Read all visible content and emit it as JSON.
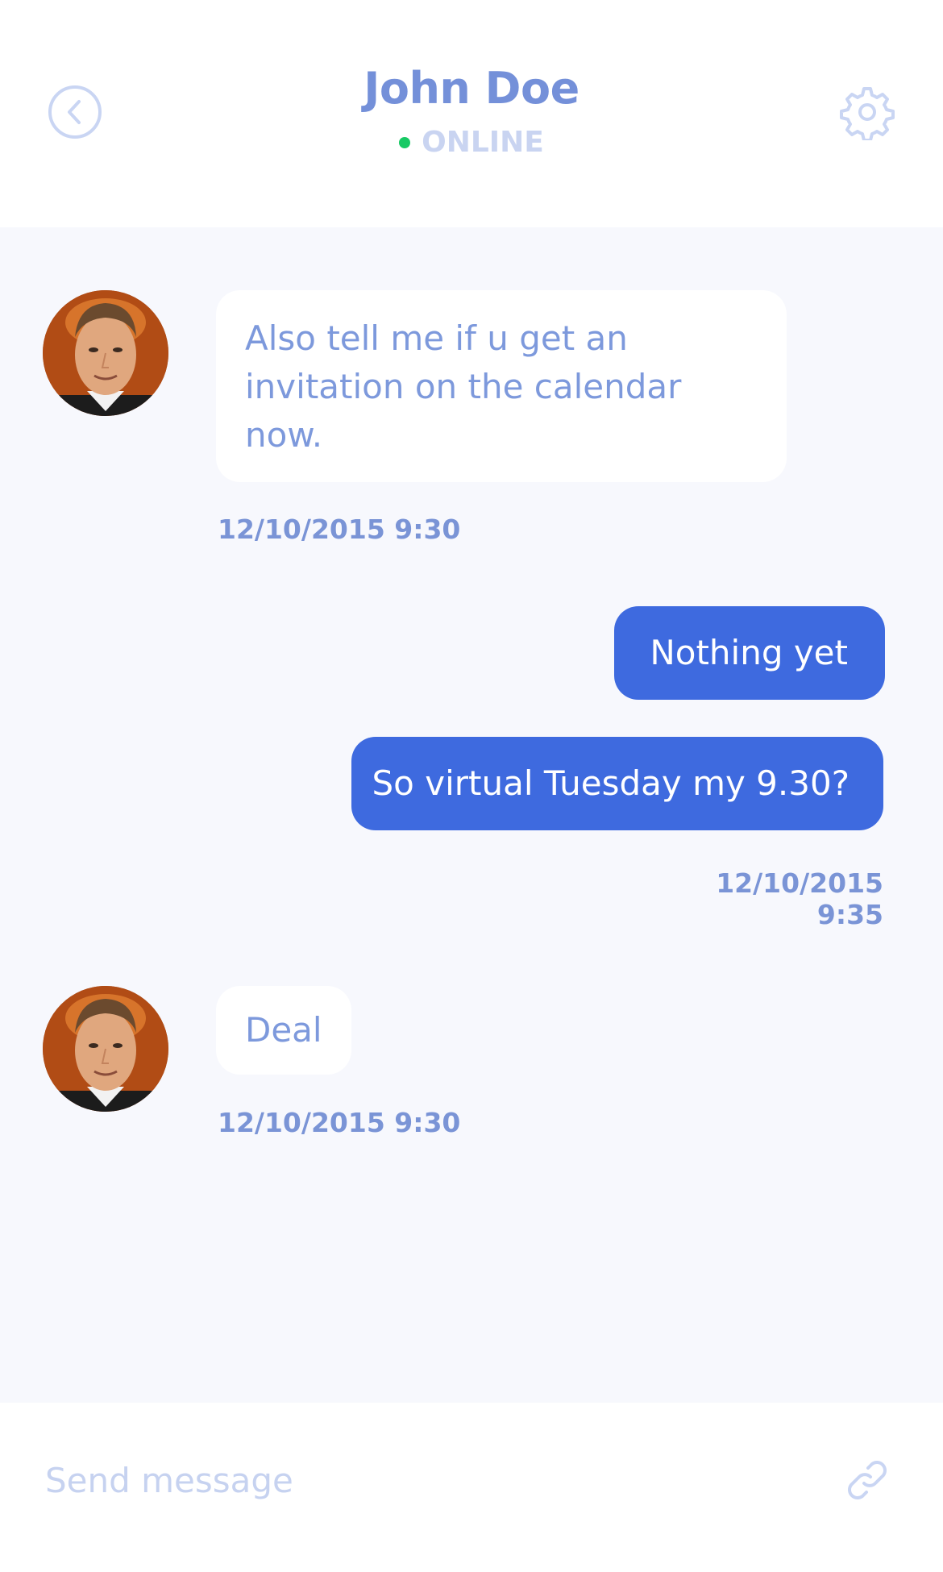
{
  "header": {
    "contact_name": "John Doe",
    "status": "ONLINE",
    "status_color": "#17c964"
  },
  "icons": {
    "back": "chevron-left-circle-icon",
    "settings": "gear-icon",
    "attach": "link-icon"
  },
  "messages": [
    {
      "direction": "incoming",
      "text": "Also tell me if u get an invitation on the calendar now.",
      "lines": [
        "Also tell me if u get an",
        "invitation on the calendar",
        "now."
      ],
      "timestamp": "12/10/2015 9:30"
    },
    {
      "direction": "outgoing",
      "text": "Nothing yet"
    },
    {
      "direction": "outgoing",
      "text": "So virtual Tuesday my 9.30?",
      "timestamp": "12/10/2015 9:35"
    },
    {
      "direction": "incoming",
      "text": "Deal",
      "timestamp": "12/10/2015 9:30"
    }
  ],
  "composer": {
    "placeholder": "Send message",
    "value": ""
  },
  "colors": {
    "accent": "#3e6adf",
    "text_primary": "#7490d9",
    "background": "#f7f8fd"
  }
}
